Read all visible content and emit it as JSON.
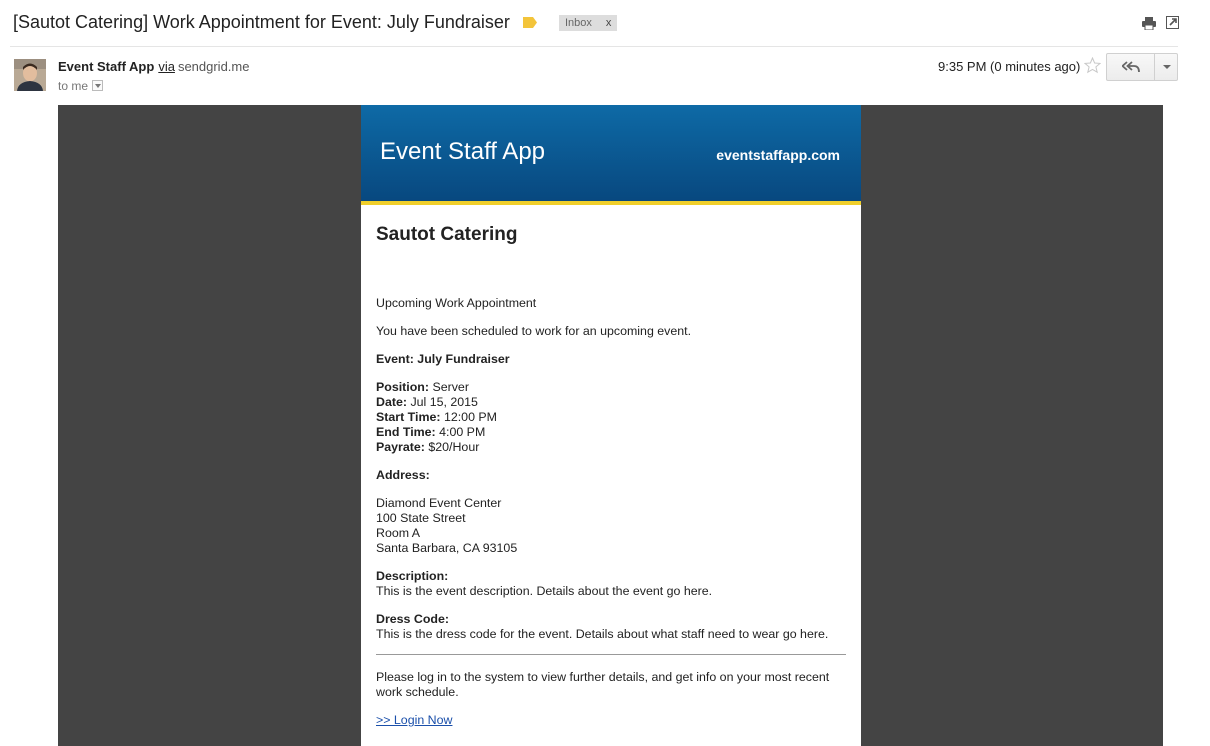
{
  "subject": {
    "text": "[Sautot Catering] Work Appointment for Event: July Fundraiser",
    "label": "Inbox",
    "label_remove": "x"
  },
  "sender": {
    "name": "Event Staff App",
    "via": "via",
    "domain": "sendgrid.me",
    "recipient": "to me",
    "time": "9:35 PM (0 minutes ago)"
  },
  "email": {
    "header_title": "Event Staff App",
    "header_link": "eventstaffapp.com",
    "company": "Sautot Catering",
    "intro_heading": "Upcoming Work Appointment",
    "intro_text": "You have been scheduled to work for an upcoming event.",
    "event_line": "Event: July Fundraiser",
    "details": [
      {
        "label": "Position:",
        "value": "Server"
      },
      {
        "label": "Date:",
        "value": "Jul 15, 2015"
      },
      {
        "label": "Start Time:",
        "value": "12:00 PM"
      },
      {
        "label": "End Time:",
        "value": "4:00 PM"
      },
      {
        "label": "Payrate:",
        "value": "$20/Hour"
      }
    ],
    "address_label": "Address:",
    "address_lines": [
      "Diamond Event Center",
      "100 State Street",
      "Room A",
      "Santa Barbara, CA 93105"
    ],
    "description_label": "Description:",
    "description_text": "This is the event description. Details about the event go here.",
    "dress_code_label": "Dress Code:",
    "dress_code_text": "This is the dress code for the event. Details about what staff need to wear go here.",
    "footer_text": "Please log in to the system to view further details, and get info on your most recent work schedule.",
    "login_link": ">> Login Now"
  },
  "colors": {
    "header_top": "#0e6aa6",
    "header_bottom": "#08487f",
    "header_accent": "#f0cf2b",
    "canvas_bg": "#444444",
    "link": "#1a4faa",
    "label_tag": "#f3c43a"
  },
  "icons": {
    "label_tag": "label-tag-icon",
    "print": "print-icon",
    "popout": "popout-icon",
    "star": "star-icon",
    "reply": "reply-all-icon",
    "more": "chevron-down-icon"
  }
}
